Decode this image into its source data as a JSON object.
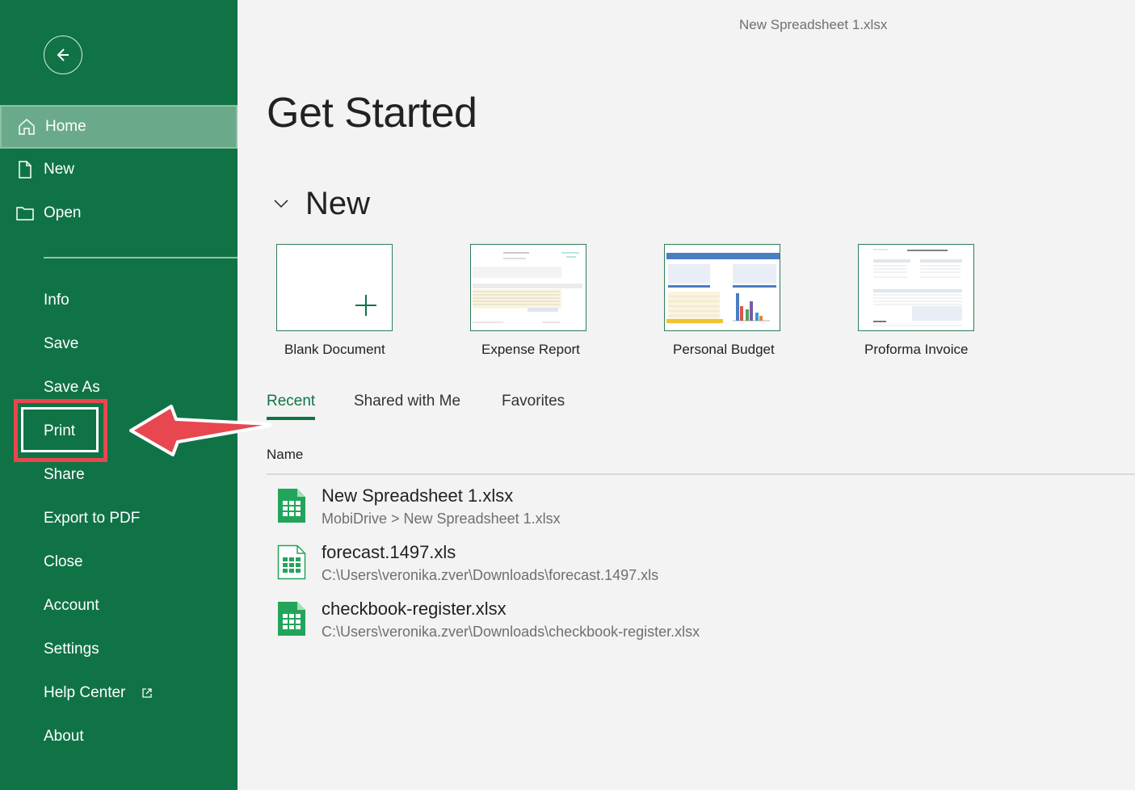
{
  "window": {
    "doc_title": "New Spreadsheet 1.xlsx"
  },
  "sidebar": {
    "top_items": [
      {
        "label": "Home",
        "icon": "home-icon",
        "active": true
      },
      {
        "label": "New",
        "icon": "file-icon"
      },
      {
        "label": "Open",
        "icon": "folder-icon"
      }
    ],
    "items": [
      {
        "label": "Info"
      },
      {
        "label": "Save"
      },
      {
        "label": "Save As"
      },
      {
        "label": "Print"
      },
      {
        "label": "Share"
      },
      {
        "label": "Export to PDF"
      },
      {
        "label": "Close"
      },
      {
        "label": "Account"
      },
      {
        "label": "Settings"
      },
      {
        "label": "Help Center",
        "icon": "external-link-icon"
      },
      {
        "label": "About"
      }
    ]
  },
  "main": {
    "heading": "Get Started",
    "new_section": {
      "title": "New",
      "templates": [
        {
          "label": "Blank Document"
        },
        {
          "label": "Expense Report"
        },
        {
          "label": "Personal Budget"
        },
        {
          "label": "Proforma Invoice"
        }
      ]
    },
    "tabs": [
      {
        "label": "Recent",
        "active": true
      },
      {
        "label": "Shared with Me"
      },
      {
        "label": "Favorites"
      }
    ],
    "list_header": "Name",
    "files": [
      {
        "name": "New Spreadsheet 1.xlsx",
        "path": "MobiDrive > New Spreadsheet 1.xlsx",
        "icon": "spreadsheet-icon"
      },
      {
        "name": "forecast.1497.xls",
        "path": "C:\\Users\\veronika.zver\\Downloads\\forecast.1497.xls",
        "icon": "spreadsheet-outline-icon"
      },
      {
        "name": "checkbook-register.xlsx",
        "path": "C:\\Users\\veronika.zver\\Downloads\\checkbook-register.xlsx",
        "icon": "spreadsheet-icon"
      }
    ]
  },
  "colors": {
    "sidebar": "#107346",
    "accent": "#107346",
    "highlight": "#e8474f"
  }
}
